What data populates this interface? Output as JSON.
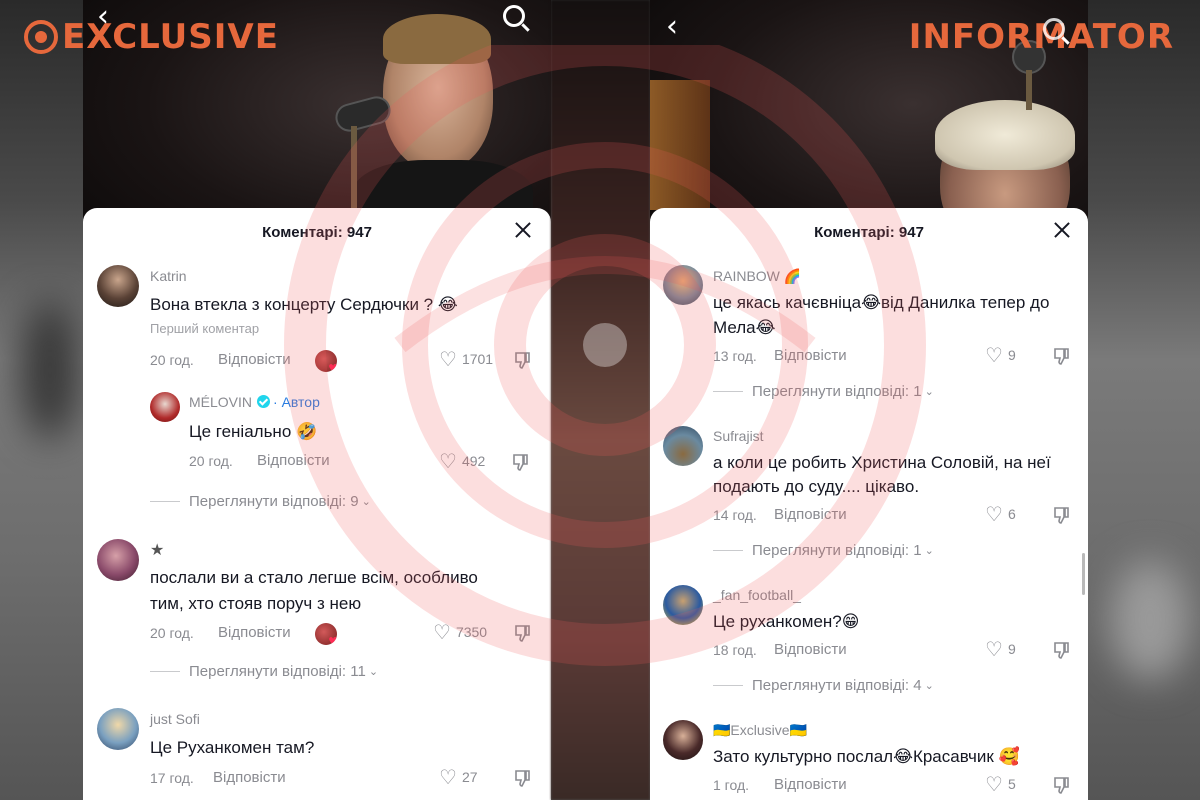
{
  "watermark_color": "#f05a5a",
  "left": {
    "brand": "EXCLUSIVE",
    "header": {
      "title": "Коментарі: 947"
    },
    "comments": [
      {
        "user": "Katrin",
        "text": "Вона втекла з концерту Сердючки ? 😂",
        "note": "Перший коментар",
        "time": "20 год.",
        "reply": "Відповісти",
        "likes": "1701"
      },
      {
        "user": "MÉLOVIN",
        "author_tag": "· Автор",
        "text": "Це геніально 🤣",
        "time": "20 год.",
        "reply": "Відповісти",
        "likes": "492"
      },
      {
        "user": "★",
        "text_line1": "послали ви а стало легше всім, особливо",
        "text_line2": "тим, хто стояв поруч з нею",
        "time": "20 год.",
        "reply": "Відповісти",
        "likes": "7350"
      },
      {
        "user": "just Sofi",
        "text": "Це Руханкомен там?",
        "time": "17 год.",
        "reply": "Відповісти",
        "likes": "27"
      }
    ],
    "view_replies": [
      "Переглянути відповіді: 9",
      "Переглянути відповіді: 11"
    ]
  },
  "right": {
    "brand": "INFORMATOR",
    "header": {
      "title": "Коментарі: 947"
    },
    "comments": [
      {
        "user": "RAINBOW 🌈",
        "text_line1": "це якась качєвніца😂від Данилка тепер до",
        "text_line2": "Мела😂",
        "time": "13 год.",
        "reply": "Відповісти",
        "likes": "9"
      },
      {
        "user": "Sufrajist",
        "text_line1": "а коли це робить Христина Соловій, на неї",
        "text_line2": "подають до суду.... цікаво.",
        "time": "14 год.",
        "reply": "Відповісти",
        "likes": "6"
      },
      {
        "user": "_fan_football_",
        "text": "Це руханкомен?😁",
        "time": "18 год.",
        "reply": "Відповісти",
        "likes": "9"
      },
      {
        "user": "🇺🇦Exclusive🇺🇦",
        "text": "Зато культурно послал😂Красавчик 🥰",
        "time": "1 год.",
        "reply": "Відповісти",
        "likes": "5"
      }
    ],
    "view_replies": [
      "Переглянути відповіді: 1",
      "Переглянути відповіді: 1",
      "Переглянути відповіді: 4"
    ]
  }
}
